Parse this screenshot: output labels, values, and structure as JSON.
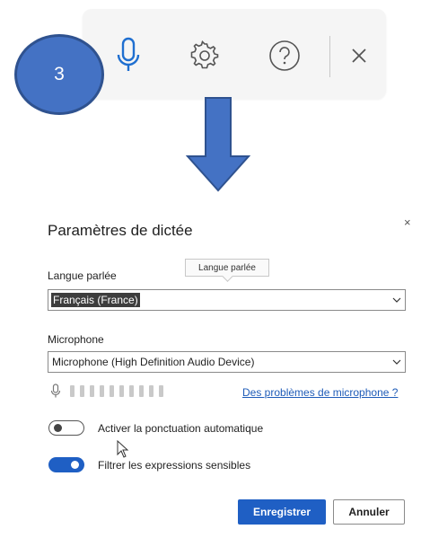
{
  "toolbar": {
    "icons": [
      "microphone-icon",
      "gear-icon",
      "help-icon",
      "close-icon"
    ],
    "accent": "#1f6fd0"
  },
  "step_badge": {
    "label": "3",
    "color": "#4472c4"
  },
  "dialog": {
    "title": "Paramètres de dictée",
    "close_glyph": "×",
    "spoken_language": {
      "label": "Langue parlée",
      "tooltip": "Langue parlée",
      "value": "Français (France)"
    },
    "microphone": {
      "label": "Microphone",
      "value": "Microphone (High Definition Audio Device)",
      "level_bars": 10,
      "level": 0
    },
    "troubleshoot_link": "Des problèmes de microphone ?",
    "toggles": {
      "auto_punctuation": {
        "label": "Activer la ponctuation automatique",
        "on": false
      },
      "filter_sensitive": {
        "label": "Filtrer les expressions sensibles",
        "on": true
      }
    },
    "buttons": {
      "save": "Enregistrer",
      "cancel": "Annuler"
    }
  },
  "colors": {
    "primary": "#1f5fc4",
    "link": "#1f5cb8",
    "badge": "#4472c4",
    "arrow": "#4472c4"
  }
}
